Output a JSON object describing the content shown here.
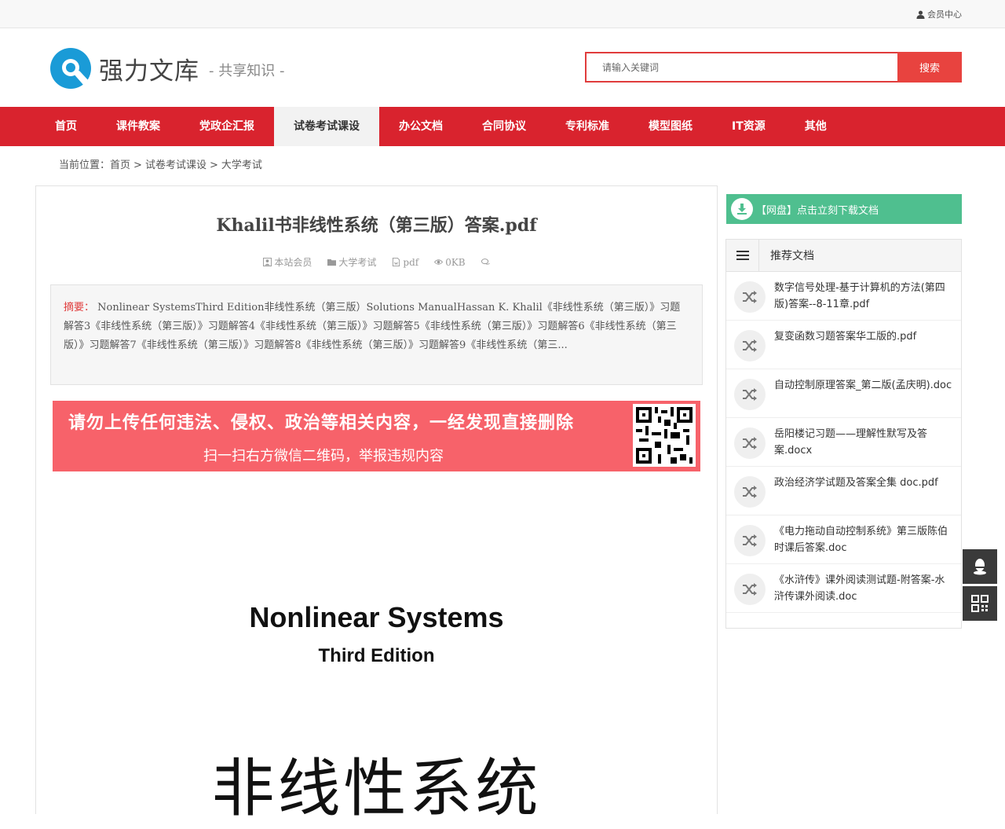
{
  "topbar": {
    "member_center": "会员中心",
    "icon": "user-icon"
  },
  "header": {
    "logo_text": "强力文库",
    "tagline": "- 共享知识 -",
    "search_placeholder": "请输入关键词",
    "search_button": "搜索",
    "brand_color": "#1a9bd7"
  },
  "nav": {
    "items": [
      "首页",
      "课件教案",
      "党政企汇报",
      "试卷考试课设",
      "办公文档",
      "合同协议",
      "专利标准",
      "模型图纸",
      "IT资源",
      "其他"
    ],
    "active": "试卷考试课设",
    "color": "#d9232e"
  },
  "breadcrumb": {
    "prefix": "当前位置：",
    "items": [
      "首页",
      "试卷考试课设",
      "大学考试"
    ],
    "separator": ">"
  },
  "document": {
    "title": "Khalil书非线性系统（第三版）答案.pdf",
    "meta": {
      "author": "本站会员",
      "category": "大学考试",
      "format": "pdf",
      "size": "0KB"
    },
    "summary_label": "摘要：",
    "summary": "Nonlinear SystemsThird Edition非线性系统（第三版）Solutions ManualHassan K. Khalil《非线性系统（第三版）》习题解答3《非线性系统（第三版）》习题解答4《非线性系统（第三版）》习题解答5《非线性系统（第三版）》习题解答6《非线性系统（第三版）》习题解答7《非线性系统（第三版）》习题解答8《非线性系统（第三版）》习题解答9《非线性系统（第三..."
  },
  "warning": {
    "line1": "请勿上传任何违法、侵权、政治等相关内容，一经发现直接删除",
    "line2": "扫一扫右方微信二维码，举报违规内容",
    "color": "#f7626a"
  },
  "preview": {
    "title": "Nonlinear Systems",
    "edition": "Third Edition",
    "chinese_title": "非线性系统"
  },
  "sidebar": {
    "download_text": "【网盘】点击立刻下载文档",
    "download_color": "#4fbf8f",
    "recommend_title": "推荐文档",
    "recommended": [
      "数字信号处理-基于计算机的方法(第四版)答案--8-11章.pdf",
      "复变函数习题答案华工版的.pdf",
      "自动控制原理答案_第二版(孟庆明).doc",
      "岳阳楼记习题——理解性默写及答案.docx",
      "政治经济学试题及答案全集 doc.pdf",
      "《电力拖动自动控制系统》第三版陈伯时课后答案.doc",
      "《水浒传》课外阅读测试题-附答案-水浒传课外阅读.doc"
    ]
  },
  "floating": [
    "qq-icon",
    "qrcode-icon"
  ]
}
